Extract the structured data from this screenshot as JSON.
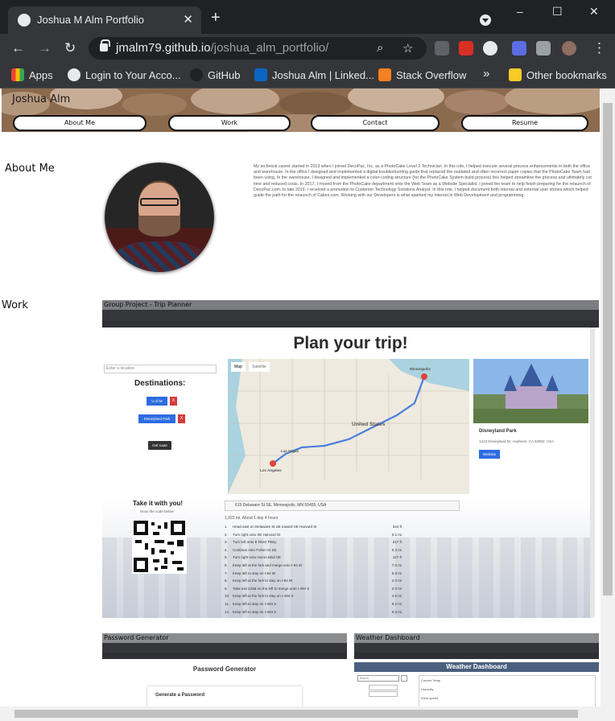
{
  "browser": {
    "tab_title": "Joshua M Alm Portfolio",
    "url_host": "jmalm79.github.io",
    "url_path": "/joshua_alm_portfolio/",
    "bookmarks": [
      {
        "label": "Apps"
      },
      {
        "label": "Login to Your Acco..."
      },
      {
        "label": "GitHub"
      },
      {
        "label": "Joshua Alm | Linked..."
      },
      {
        "label": "Stack Overflow"
      }
    ],
    "overflow_label": "»",
    "other_bookmarks": "Other bookmarks",
    "window_controls": [
      "–",
      "☐",
      "✕"
    ]
  },
  "site": {
    "name": "Joshua Alm",
    "nav": [
      "About Me",
      "Work",
      "Contact",
      "Resume"
    ]
  },
  "about": {
    "heading": "About Me",
    "text": "My technical career started in 2013 when I joined DecoPac, Inc. as a PhotoCake Level 2 Technician. In this role, I helped execute several process enhancements in both the office and warehouse. In the office I designed and implemented a digital troubleshooting guide that replaced the outdated and often incorrect paper copies that the PhotoCake Team had been using. In the warehouse, I designed and implemented a color-coding structure (for the PhotoCake System build process) this helped streamline the process and ultimately cut time and reduced costs. In 2017, I moved from the PhotoCake department onto the Web Team as a Website Specialist. I joined the team to help finish preparing for the relaunch of DecoPac.com. In late 2019, I received a promotion to Customer Technology Solutions Analyst. In this role, I helped document both internal and external user stories which helped guide the path for the relaunch of Cakes.com. Working with our Developers is what sparked my interest in Web Development and programming."
  },
  "work": {
    "heading": "Work",
    "featured": {
      "frame_title": "Group Project - Trip Planner",
      "page_title": "Plan your trip!",
      "location_placeholder": "Enter a location",
      "destinations_title": "Destinations:",
      "destinations": [
        "U of M",
        "Disneyland Park"
      ],
      "remove_label": "X",
      "get_route_label": "Get route",
      "map_tabs": [
        "Map",
        "Satellite"
      ],
      "map_labels": [
        "United States",
        "Minneapolis",
        "Los Angeles",
        "Las Vegas"
      ],
      "place_name": "Disneyland Park",
      "place_address": "1313 Disneyland Dr, Anaheim, CA 92802, USA",
      "website_label": "Website",
      "take_title": "Take it with you!",
      "scan_label": "Scan the code below",
      "route_address": "615 Delaware St SE, Minneapolis, MN 55455, USA",
      "route_summary": "1,923 mi. About 1 day 4 hours",
      "steps": [
        {
          "n": "1.",
          "text": "Head east on Delaware St SE toward SE Harvard St",
          "dist": "344 ft"
        },
        {
          "n": "2.",
          "text": "Turn right onto SE Harvard St",
          "dist": "0.2 mi"
        },
        {
          "n": "3.",
          "text": "Turn left onto E River Pkwy",
          "dist": "217 ft"
        },
        {
          "n": "4.",
          "text": "Continue onto Fulton St SE",
          "dist": "0.3 mi"
        },
        {
          "n": "5.",
          "text": "Turn right onto Huron Blvd SE",
          "dist": "427 ft"
        },
        {
          "n": "6.",
          "text": "Keep left at the fork and merge onto I-94 W",
          "dist": "7.0 mi"
        },
        {
          "n": "7.",
          "text": "Keep left to stay on I-94 W",
          "dist": "5.9 mi"
        },
        {
          "n": "8.",
          "text": "Keep left at the fork to stay on I-94 W",
          "dist": "2.0 mi"
        },
        {
          "n": "9.",
          "text": "Take exit 233B on the left to merge onto I-494 S",
          "dist": "2.0 mi"
        },
        {
          "n": "10.",
          "text": "Keep left at the fork to stay on I-494 S",
          "dist": "4.5 mi"
        },
        {
          "n": "11.",
          "text": "Keep left to stay on I-494 S",
          "dist": "9.2 mi"
        },
        {
          "n": "12.",
          "text": "Keep left to stay on I-494 S",
          "dist": "0.3 mi"
        }
      ]
    },
    "cards": [
      {
        "frame_title": "Password Generator",
        "page_title": "Password Generator",
        "sub_title": "Generate a Password"
      },
      {
        "frame_title": "Weather Dashboard",
        "page_title": "Weather Dashboard",
        "search_placeholder": "Search",
        "fields": [
          "Current Temp",
          "Humidity",
          "Wind speed"
        ]
      }
    ]
  },
  "colors": {
    "chrome_dark": "#202124",
    "chrome_toolbar": "#35363a",
    "accent_blue": "#2d6de0",
    "danger_red": "#d63a3a"
  }
}
